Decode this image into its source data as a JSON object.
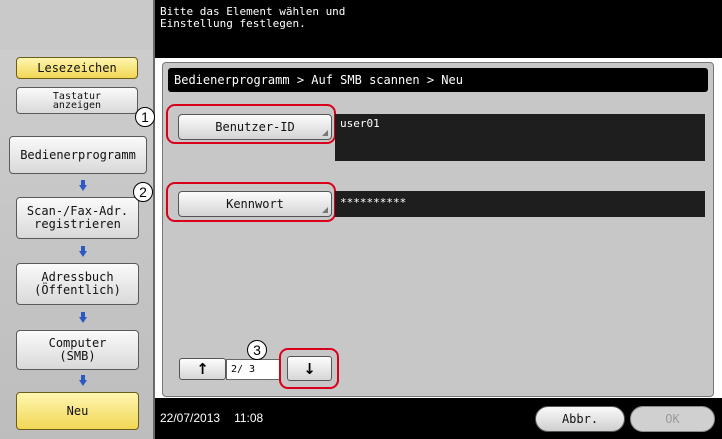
{
  "header": {
    "message": "Bitte das Element wählen und\nEinstellung festlegen."
  },
  "sidebar": {
    "bookmark_label": "Lesezeichen",
    "keyboard_label": "Tastatur\nanzeigen",
    "steps": [
      {
        "label": "Bedienerprogramm"
      },
      {
        "label": "Scan-/Fax-Adr.\nregistrieren"
      },
      {
        "label": "Adressbuch\n(Öffentlich)"
      },
      {
        "label": "Computer\n(SMB)"
      },
      {
        "label": "Neu"
      }
    ]
  },
  "breadcrumb": "Bedienerprogramm > Auf SMB scannen > Neu",
  "fields": {
    "user_id": {
      "label": "Benutzer-ID",
      "value": "user01"
    },
    "password": {
      "label": "Kennwort",
      "value": "**********"
    }
  },
  "callouts": {
    "one": "1",
    "two": "2",
    "three": "3"
  },
  "pager": {
    "indicator": "2/ 3",
    "up_icon": "arrow-up-icon",
    "down_icon": "arrow-down-icon"
  },
  "status": {
    "date": "22/07/2013",
    "time": "11:08"
  },
  "actions": {
    "cancel_label": "Abbr.",
    "ok_label": "OK"
  },
  "colors": {
    "callout_ring": "#d9001b",
    "step_arrow": "#2c59c6",
    "active_step": "#f1d755"
  }
}
